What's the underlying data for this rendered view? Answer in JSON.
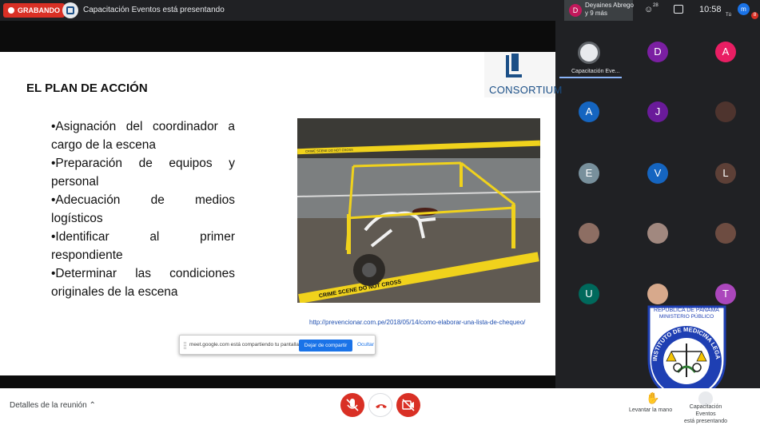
{
  "topbar": {
    "recording": "GRABANDO",
    "presenter_text": "Capacitación Eventos está presentando",
    "participants_line1": "Deyaines Abrego",
    "participants_line2": "y 9 más",
    "avatar_initial": "D",
    "people_count": "28",
    "time": "10:58",
    "me_initial": "m",
    "me_label": "Tú",
    "badge": "8"
  },
  "slide": {
    "title": "EL PLAN DE ACCIÓN",
    "logo_text": "CONSORTIUM",
    "bullets": [
      "•Asignación del coordinador a cargo de la escena",
      "•Preparación de equipos y personal",
      "•Adecuación de medios logísticos",
      "•Identificar al primer respondiente",
      "•Determinar las condiciones originales de la escena"
    ],
    "tape_text": "CRIME SCENE DO NOT CROSS",
    "source_link": "http://prevencionar.com.pe/2018/05/14/como-elaborar-una-lista-de-chequeo/"
  },
  "share_bar": {
    "message": "meet.google.com está compartiendo tu pantalla.",
    "stop_label": "Dejar de compartir",
    "hide_label": "Ocultar"
  },
  "grid": {
    "presenter_tile_label": "Capacitación Eve...",
    "tiles": [
      {
        "initial": "D",
        "color": "#7b1fa2"
      },
      {
        "initial": "A",
        "color": "#e91e63"
      },
      {
        "initial": "A",
        "color": "#1565c0"
      },
      {
        "initial": "J",
        "color": "#6a1b9a"
      },
      {
        "initial": "",
        "color": "#4e342e"
      },
      {
        "initial": "E",
        "color": "#78909c"
      },
      {
        "initial": "V",
        "color": "#1565c0"
      },
      {
        "initial": "L",
        "color": "#5d4037"
      },
      {
        "initial": "",
        "color": "#8d6e63"
      },
      {
        "initial": "",
        "color": "#a1887f"
      },
      {
        "initial": "",
        "color": "#6d4c41"
      },
      {
        "initial": "U",
        "color": "#00695c"
      },
      {
        "initial": "",
        "color": "#d7a98c"
      },
      {
        "initial": "T",
        "color": "#ab47bc"
      }
    ]
  },
  "seal": {
    "top_line1": "REPÚBLICA DE PANAMÁ",
    "top_line2": "MINISTERIO PÚBLICO",
    "ring_text": "INSTITUTO DE MEDICINA LEGAL Y CIENCIAS FORENSES"
  },
  "bottombar": {
    "details": "Detalles de la reunión",
    "raise_hand": "Levantar la mano",
    "presenting_line1": "Capacitación Eventos",
    "presenting_line2": "está presentando"
  },
  "colors": {
    "accent": "#1a73e8",
    "danger": "#d93025",
    "dark": "#202124"
  }
}
